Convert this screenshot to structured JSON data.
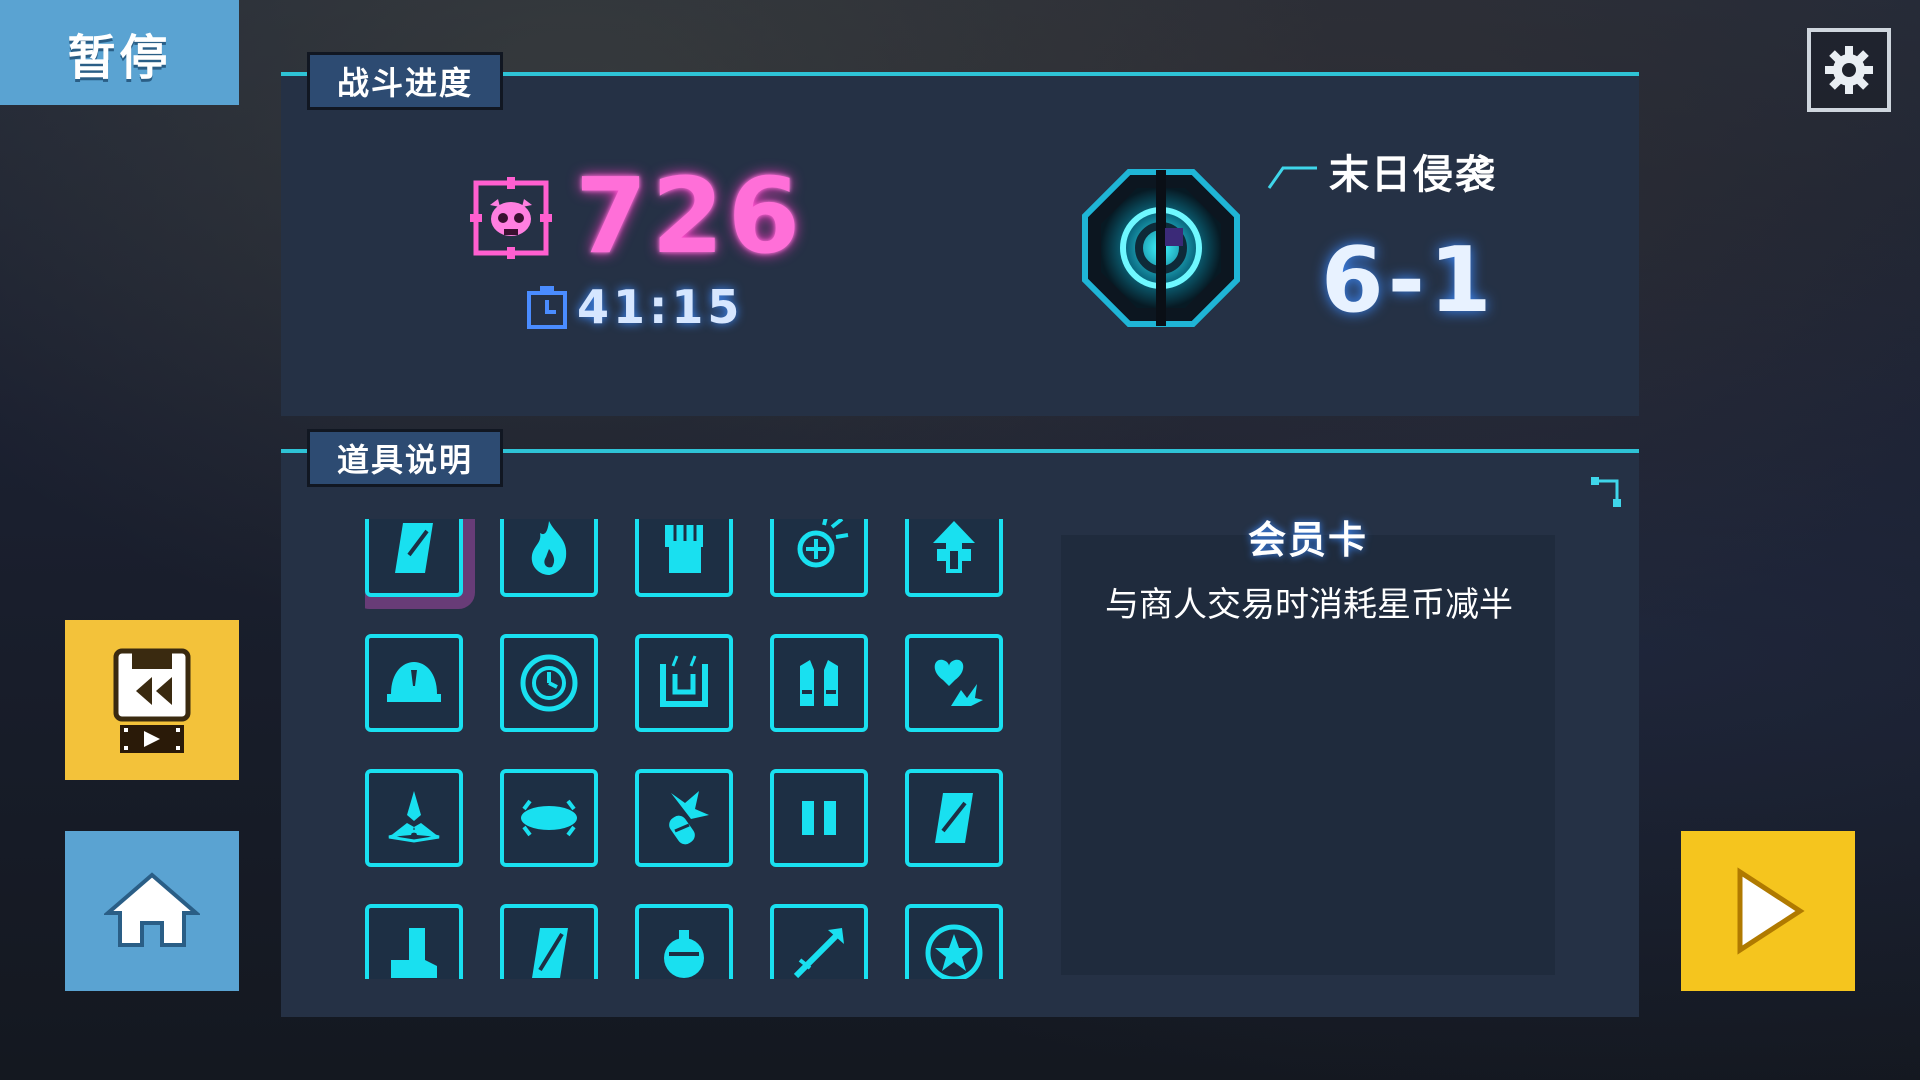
{
  "header": {
    "pause_label": "暂停"
  },
  "progress_panel": {
    "tab_label": "战斗进度",
    "kill_count": "726",
    "timer": "41:15",
    "stage_name": "末日侵袭",
    "stage_number": "6-1",
    "icons": {
      "kills": "skull-target-icon",
      "timer": "stopwatch-icon",
      "portal": "portal-icon"
    }
  },
  "items_panel": {
    "tab_label": "道具说明",
    "selected_item_index": 0,
    "items": [
      {
        "icon": "membership-card-icon"
      },
      {
        "icon": "flame-icon"
      },
      {
        "icon": "fist-icon"
      },
      {
        "icon": "crosshair-burst-icon"
      },
      {
        "icon": "arrow-up-plus-icon"
      },
      {
        "icon": "helmet-icon"
      },
      {
        "icon": "clock-ring-icon"
      },
      {
        "icon": "recycle-box-icon"
      },
      {
        "icon": "vest-icon"
      },
      {
        "icon": "heart-explosion-icon"
      },
      {
        "icon": "tri-blade-icon"
      },
      {
        "icon": "saucer-icon"
      },
      {
        "icon": "capsule-burst-icon"
      },
      {
        "icon": "pause-bars-icon"
      },
      {
        "icon": "card-icon"
      },
      {
        "icon": "boot-icon"
      },
      {
        "icon": "card-slice-icon"
      },
      {
        "icon": "potion-icon"
      },
      {
        "icon": "arrow-strike-icon"
      },
      {
        "icon": "star-badge-icon"
      }
    ],
    "detail": {
      "title": "会员卡",
      "description": "与商人交易时消耗星币减半"
    }
  },
  "buttons": {
    "settings": "gear-icon",
    "restore": "save-rewind-icon",
    "home": "home-icon",
    "resume": "play-icon"
  },
  "colors": {
    "accent_cyan": "#19e0f0",
    "kill_pink": "#ff6fd8",
    "panel_bg": "#253145",
    "yellow_button": "#f5c51e",
    "blue_button": "#5aa3d2"
  }
}
